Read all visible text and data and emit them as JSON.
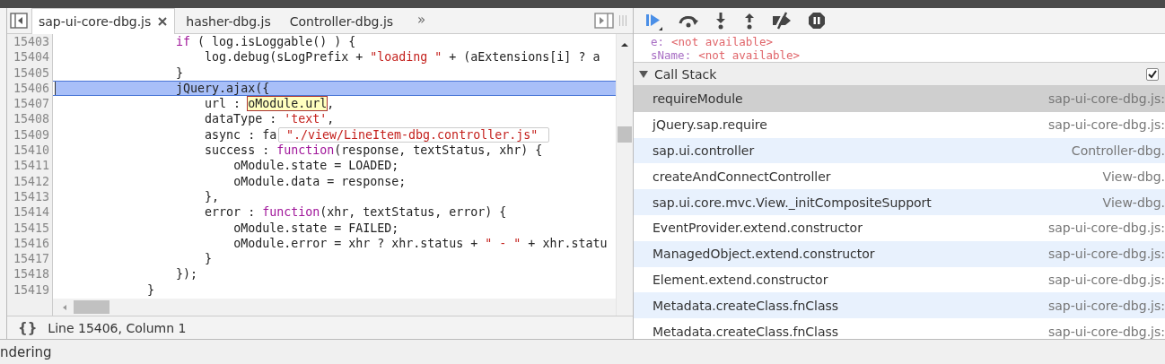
{
  "editor": {
    "tabs": [
      {
        "label": "sap-ui-core-dbg.js",
        "selected": true,
        "closable": true
      },
      {
        "label": "hasher-dbg.js",
        "selected": false,
        "closable": false
      },
      {
        "label": "Controller-dbg.js",
        "selected": false,
        "closable": false
      }
    ],
    "overflow_button": "»",
    "lines": [
      {
        "number": "15403",
        "current": false,
        "tokens": [
          {
            "kind": "keyword",
            "text": "                if"
          },
          {
            "kind": "plain",
            "text": " ( log.isLoggable() ) {"
          }
        ]
      },
      {
        "number": "15404",
        "current": false,
        "tokens": [
          {
            "kind": "plain",
            "text": "                    log.debug(sLogPrefix + "
          },
          {
            "kind": "string",
            "text": "\"loading \""
          },
          {
            "kind": "plain",
            "text": " + (aExtensions[i] ? a"
          }
        ]
      },
      {
        "number": "15405",
        "current": false,
        "tokens": [
          {
            "kind": "plain",
            "text": "                }"
          }
        ]
      },
      {
        "number": "15406",
        "current": true,
        "tokens": [
          {
            "kind": "plain",
            "text": "                jQuery.ajax({"
          }
        ]
      },
      {
        "number": "15407",
        "current": false,
        "tokens": [
          {
            "kind": "plain",
            "text": "                    url : "
          },
          {
            "kind": "hover",
            "text": "oModule.url"
          },
          {
            "kind": "plain",
            "text": ","
          }
        ]
      },
      {
        "number": "15408",
        "current": false,
        "tokens": [
          {
            "kind": "plain",
            "text": "                    dataType : "
          },
          {
            "kind": "string",
            "text": "'text'"
          },
          {
            "kind": "plain",
            "text": ","
          }
        ]
      },
      {
        "number": "15409",
        "current": false,
        "tokens": [
          {
            "kind": "plain",
            "text": "                    async : fa"
          }
        ]
      },
      {
        "number": "15410",
        "current": false,
        "tokens": [
          {
            "kind": "plain",
            "text": "                    success : "
          },
          {
            "kind": "keyword",
            "text": "function"
          },
          {
            "kind": "plain",
            "text": "(response, textStatus, xhr) {"
          }
        ]
      },
      {
        "number": "15411",
        "current": false,
        "tokens": [
          {
            "kind": "plain",
            "text": "                        oModule.state = LOADED;"
          }
        ]
      },
      {
        "number": "15412",
        "current": false,
        "tokens": [
          {
            "kind": "plain",
            "text": "                        oModule.data = response;"
          }
        ]
      },
      {
        "number": "15413",
        "current": false,
        "tokens": [
          {
            "kind": "plain",
            "text": "                    },"
          }
        ]
      },
      {
        "number": "15414",
        "current": false,
        "tokens": [
          {
            "kind": "plain",
            "text": "                    error : "
          },
          {
            "kind": "keyword",
            "text": "function"
          },
          {
            "kind": "plain",
            "text": "(xhr, textStatus, error) {"
          }
        ]
      },
      {
        "number": "15415",
        "current": false,
        "tokens": [
          {
            "kind": "plain",
            "text": "                        oModule.state = FAILED;"
          }
        ]
      },
      {
        "number": "15416",
        "current": false,
        "tokens": [
          {
            "kind": "plain",
            "text": "                        oModule.error = xhr ? xhr.status + "
          },
          {
            "kind": "string",
            "text": "\" - \""
          },
          {
            "kind": "plain",
            "text": " + xhr.statu"
          }
        ]
      },
      {
        "number": "15417",
        "current": false,
        "tokens": [
          {
            "kind": "plain",
            "text": "                    }"
          }
        ]
      },
      {
        "number": "15418",
        "current": false,
        "tokens": [
          {
            "kind": "plain",
            "text": "                });"
          }
        ]
      },
      {
        "number": "15419",
        "current": false,
        "tokens": [
          {
            "kind": "plain",
            "text": "            }"
          }
        ]
      }
    ],
    "tooltip": "\"./view/LineItem-dbg.controller.js\"",
    "pretty_print_button": "{}",
    "cursor_position": "Line 15406, Column 1"
  },
  "debugger": {
    "scope": [
      {
        "name": "e:",
        "value": "<not available>"
      },
      {
        "name": "sName:",
        "value": "<not available>"
      }
    ],
    "call_stack": {
      "title": "Call Stack",
      "expanded": true,
      "checkbox_checked": true,
      "frames": [
        {
          "function": "requireModule",
          "location": "sap-ui-core-dbg.js:",
          "selected": true
        },
        {
          "function": "jQuery.sap.require",
          "location": "sap-ui-core-dbg.js:",
          "selected": false
        },
        {
          "function": "sap.ui.controller",
          "location": "Controller-dbg.",
          "selected": false
        },
        {
          "function": "createAndConnectController",
          "location": "View-dbg.",
          "selected": false
        },
        {
          "function": "sap.ui.core.mvc.View._initCompositeSupport",
          "location": "View-dbg.",
          "selected": false
        },
        {
          "function": "EventProvider.extend.constructor",
          "location": "sap-ui-core-dbg.js:",
          "selected": false
        },
        {
          "function": "ManagedObject.extend.constructor",
          "location": "sap-ui-core-dbg.js:",
          "selected": false
        },
        {
          "function": "Element.extend.constructor",
          "location": "sap-ui-core-dbg.js:",
          "selected": false
        },
        {
          "function": "Metadata.createClass.fnClass",
          "location": "sap-ui-core-dbg.js:",
          "selected": false
        },
        {
          "function": "Metadata.createClass.fnClass",
          "location": "sap-ui-core-dbg.js:",
          "selected": false
        }
      ]
    }
  },
  "status_bar": {
    "text": "ndering"
  }
}
